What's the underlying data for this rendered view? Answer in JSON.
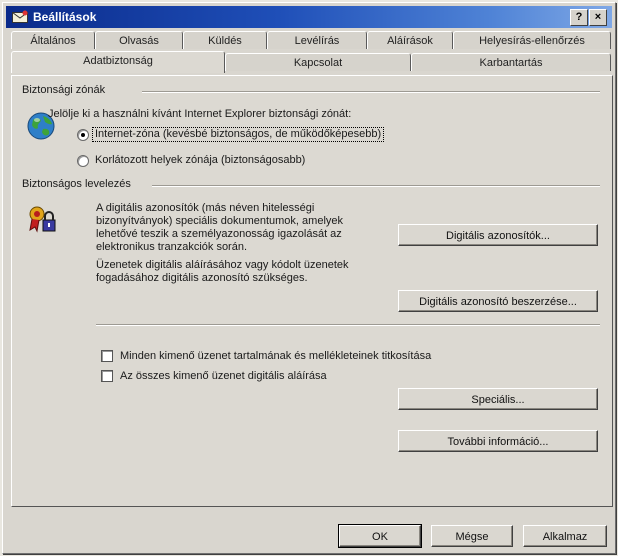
{
  "window": {
    "title": "Beállítások",
    "help_glyph": "?",
    "close_glyph": "×"
  },
  "tabs_row1": [
    "Általános",
    "Olvasás",
    "Küldés",
    "Levélírás",
    "Aláírások",
    "Helyesírás-ellenőrzés"
  ],
  "tabs_row2": [
    "Adatbiztonság",
    "Kapcsolat",
    "Karbantartás"
  ],
  "zones": {
    "group_label": "Biztonsági zónák",
    "prompt": "Jelölje ki a használni kívánt Internet Explorer biztonsági zónát:",
    "option_internet": "Internet-zóna (kevésbé biztonságos, de működőképesebb)",
    "option_restricted": "Korlátozott helyek zónája (biztonságosabb)",
    "selected": "internet"
  },
  "mail": {
    "group_label": "Biztonságos levelezés",
    "desc1": [
      "A digitális azonosítók (más néven hitelességi",
      "bizonyítványok) speciális dokumentumok, amelyek",
      "lehetővé teszik a személyazonosság igazolását az",
      "elektronikus tranzakciók során."
    ],
    "desc2": [
      "Üzenetek digitális aláírásához vagy kódolt üzenetek",
      "fogadásához digitális azonosító szükséges."
    ],
    "btn_ids": "Digitális azonosítók...",
    "btn_get_id": "Digitális azonosító beszerzése...",
    "chk_encrypt": "Minden kimenő üzenet tartalmának és mellékleteinek titkosítása",
    "chk_sign": "Az összes kimenő üzenet digitális aláírása",
    "btn_advanced": "Speciális...",
    "btn_more_info": "További információ..."
  },
  "footer": {
    "ok": "OK",
    "cancel": "Mégse",
    "apply": "Alkalmaz"
  },
  "colors": {
    "title_start": "#0a2a8a",
    "title_end": "#7fa8e6",
    "face": "#dcd9d2"
  }
}
